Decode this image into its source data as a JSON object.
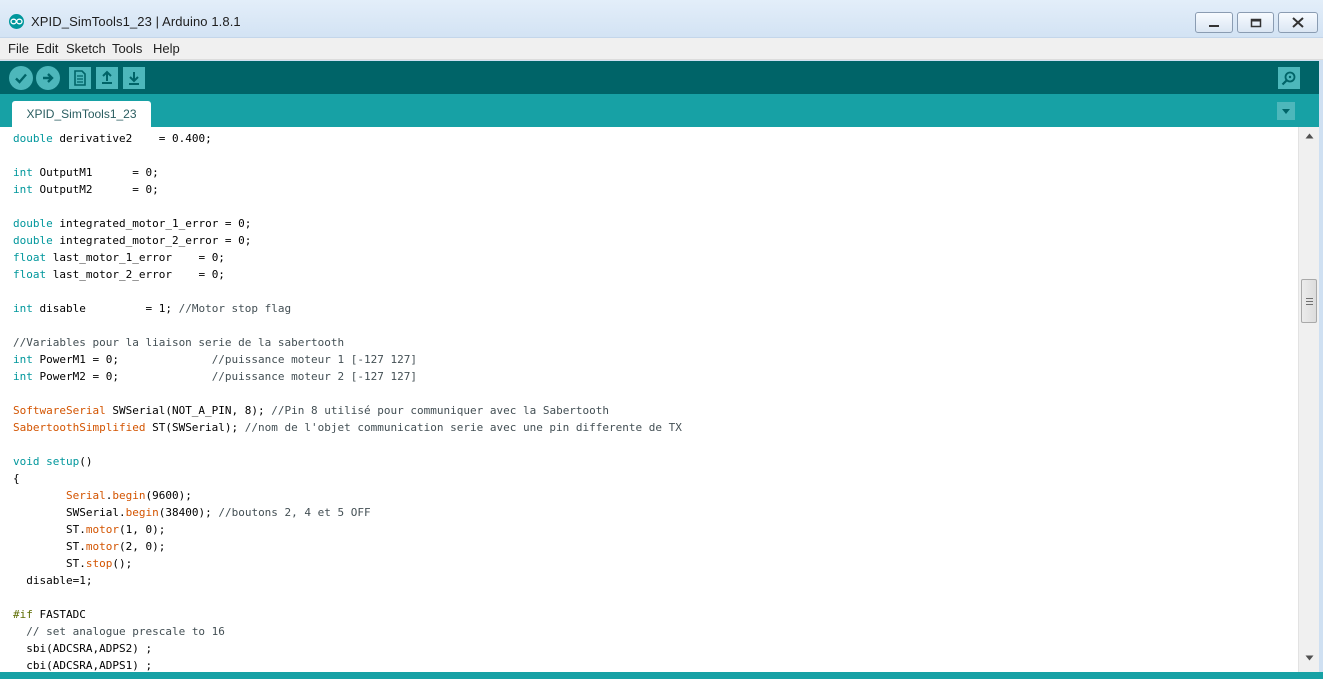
{
  "window": {
    "title": "XPID_SimTools1_23 | Arduino 1.8.1",
    "controls": [
      "minimize-icon",
      "maximize-icon",
      "close-icon"
    ]
  },
  "menu": {
    "file": "File",
    "edit": "Edit",
    "sketch": "Sketch",
    "tools": "Tools",
    "help": "Help"
  },
  "toolbar": {
    "buttons": [
      "verify-icon",
      "upload-icon",
      "new-icon",
      "open-icon",
      "save-icon",
      "serial-monitor-icon"
    ]
  },
  "tabs": [
    {
      "label": "XPID_SimTools1_23"
    }
  ],
  "editor": {
    "lines": [
      [
        [
          "kw",
          "double"
        ],
        [
          "t",
          " derivative2    = 0.400;"
        ]
      ],
      [],
      [
        [
          "kw",
          "int"
        ],
        [
          "t",
          " OutputM1      = 0;"
        ]
      ],
      [
        [
          "kw",
          "int"
        ],
        [
          "t",
          " OutputM2      = 0;"
        ]
      ],
      [],
      [
        [
          "kw",
          "double"
        ],
        [
          "t",
          " integrated_motor_1_error = 0;"
        ]
      ],
      [
        [
          "kw",
          "double"
        ],
        [
          "t",
          " integrated_motor_2_error = 0;"
        ]
      ],
      [
        [
          "kw",
          "float"
        ],
        [
          "t",
          " last_motor_1_error    = 0;"
        ]
      ],
      [
        [
          "kw",
          "float"
        ],
        [
          "t",
          " last_motor_2_error    = 0;"
        ]
      ],
      [],
      [
        [
          "kw",
          "int"
        ],
        [
          "t",
          " disable         = 1; "
        ],
        [
          "cm",
          "//Motor stop flag"
        ]
      ],
      [],
      [
        [
          "cm",
          "//Variables pour la liaison serie de la sabertooth"
        ]
      ],
      [
        [
          "kw",
          "int"
        ],
        [
          "t",
          " PowerM1 = 0;              "
        ],
        [
          "cm",
          "//puissance moteur 1 [-127 127]"
        ]
      ],
      [
        [
          "kw",
          "int"
        ],
        [
          "t",
          " PowerM2 = 0;              "
        ],
        [
          "cm",
          "//puissance moteur 2 [-127 127]"
        ]
      ],
      [],
      [
        [
          "fn",
          "SoftwareSerial"
        ],
        [
          "t",
          " SWSerial(NOT_A_PIN, 8); "
        ],
        [
          "cm",
          "//Pin 8 utilisé pour communiquer avec la Sabertooth"
        ]
      ],
      [
        [
          "fn",
          "SabertoothSimplified"
        ],
        [
          "t",
          " ST(SWSerial); "
        ],
        [
          "cm",
          "//nom de l'objet communication serie avec une pin differente de TX"
        ]
      ],
      [],
      [
        [
          "kw",
          "void"
        ],
        [
          "t",
          " "
        ],
        [
          "kw",
          "setup"
        ],
        [
          "t",
          "()"
        ]
      ],
      [
        [
          "t",
          "{"
        ]
      ],
      [
        [
          "t",
          "        "
        ],
        [
          "fn",
          "Serial"
        ],
        [
          "t",
          "."
        ],
        [
          "fn",
          "begin"
        ],
        [
          "t",
          "(9600);"
        ]
      ],
      [
        [
          "t",
          "        SWSerial."
        ],
        [
          "fn",
          "begin"
        ],
        [
          "t",
          "(38400); "
        ],
        [
          "cm",
          "//boutons 2, 4 et 5 OFF"
        ]
      ],
      [
        [
          "t",
          "        ST."
        ],
        [
          "fn",
          "motor"
        ],
        [
          "t",
          "(1, 0);"
        ]
      ],
      [
        [
          "t",
          "        ST."
        ],
        [
          "fn",
          "motor"
        ],
        [
          "t",
          "(2, 0);"
        ]
      ],
      [
        [
          "t",
          "        ST."
        ],
        [
          "fn",
          "stop"
        ],
        [
          "t",
          "();"
        ]
      ],
      [
        [
          "t",
          "  disable=1;"
        ]
      ],
      [],
      [
        [
          "pp",
          "#if"
        ],
        [
          "t",
          " FASTADC"
        ]
      ],
      [
        [
          "t",
          "  "
        ],
        [
          "cm",
          "// set analogue prescale to 16"
        ]
      ],
      [
        [
          "t",
          "  sbi(ADCSRA,ADPS2) ;"
        ]
      ],
      [
        [
          "t",
          "  cbi(ADCSRA,ADPS1) ;"
        ]
      ]
    ]
  },
  "scrollbar": {
    "position_fraction": 0.28,
    "icons": [
      "scroll-up-arrow-icon",
      "scroll-down-arrow-icon"
    ]
  },
  "colors": {
    "toolbar": "#006468",
    "tabbar": "#17a1a5",
    "button": "#4db7bb",
    "keyword": "#00979c",
    "function": "#d35400",
    "comment": "#434f54"
  }
}
